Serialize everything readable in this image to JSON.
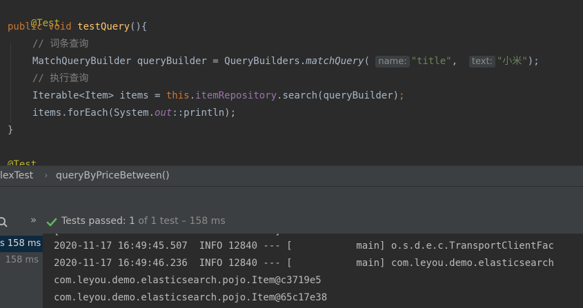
{
  "editor": {
    "annotation": "@Test",
    "sig_public": "public",
    "sig_void": "void",
    "sig_method": "testQuery",
    "sig_rest": "(){",
    "comment1": "// 词条查询",
    "l4_type": "MatchQueryBuilder queryBuilder = QueryBuilders.",
    "l4_method": "matchQuery",
    "l4_paren": "(",
    "hint_name": "name:",
    "arg_title": "\"title\"",
    "l4_comma": ", ",
    "hint_text": "text:",
    "arg_text": "\"小米\"",
    "l4_end": ");",
    "comment2": "// 执行查询",
    "l6_type": "Iterable<Item> items = ",
    "l6_this": "this",
    "l6_dot": ".",
    "l6_field": "itemRepository",
    "l6_rest": ".search(queryBuilder)",
    "l6_semi": ";",
    "l7_a": "items.forEach(System.",
    "l7_out": "out",
    "l7_b": "::println);",
    "close_brace": "}",
    "next_annotation": "@Test"
  },
  "breadcrumb": {
    "class_name": "lexTest",
    "separator": "›",
    "method": "queryByPriceBetween()"
  },
  "status": {
    "chevrons": "»",
    "passed_label": "Tests passed:",
    "passed_count": "1",
    "detail": "of 1 test – 158 ms"
  },
  "tree": {
    "row1_time": "s 158 ms",
    "row2_time": "158 ms"
  },
  "console": {
    "lines": [
      "2020-11-17 16:49:45.507  INFO 12840 --- [           main] o.s.d.e.c.TransportClientFac",
      "2020-11-17 16:49:46.236  INFO 12840 --- [           main] com.leyou.demo.elasticsearch",
      "com.leyou.demo.elasticsearch.pojo.Item@c3719e5",
      "com.leyou.demo.elasticsearch.pojo.Item@65c17e38"
    ]
  },
  "colors": {
    "passed_green": "#5fb95f",
    "tree_selected": "#0d293e"
  }
}
